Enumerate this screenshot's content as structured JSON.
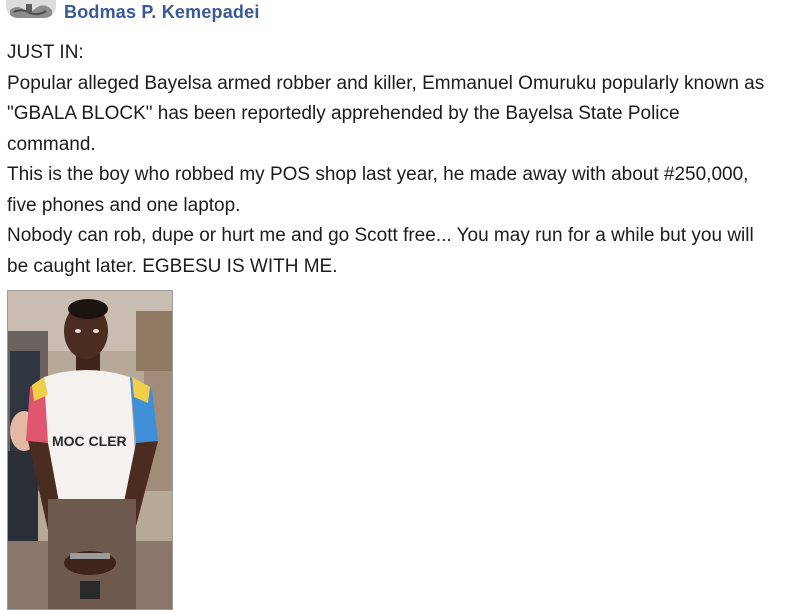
{
  "post": {
    "author_name": "Bodmas P.  Kemepadei",
    "paragraphs": [
      "JUST IN:",
      "Popular alleged Bayelsa armed robber and killer, Emmanuel Omuruku popularly known as \"GBALA BLOCK\" has been reportedly apprehended by the Bayelsa State Police command.",
      "This is the boy who robbed my POS shop last year, he made away with about #250,000, five phones and one laptop.",
      "Nobody can rob, dupe or hurt me and go Scott free... You may run for a while but you will be caught later. EGBESU IS WITH ME."
    ]
  },
  "photo": {
    "shirt_text": "MOC  CLER",
    "colors": {
      "shirt": "#f4f1ee",
      "sleeve_left": "#e0566f",
      "sleeve_left_top": "#f0d04a",
      "sleeve_right": "#3f8fd8",
      "skin": "#4a2c20",
      "background_wall": "#b9a99c"
    }
  },
  "colors": {
    "author_link": "#3b5998",
    "body_text": "#1c1c1c"
  }
}
